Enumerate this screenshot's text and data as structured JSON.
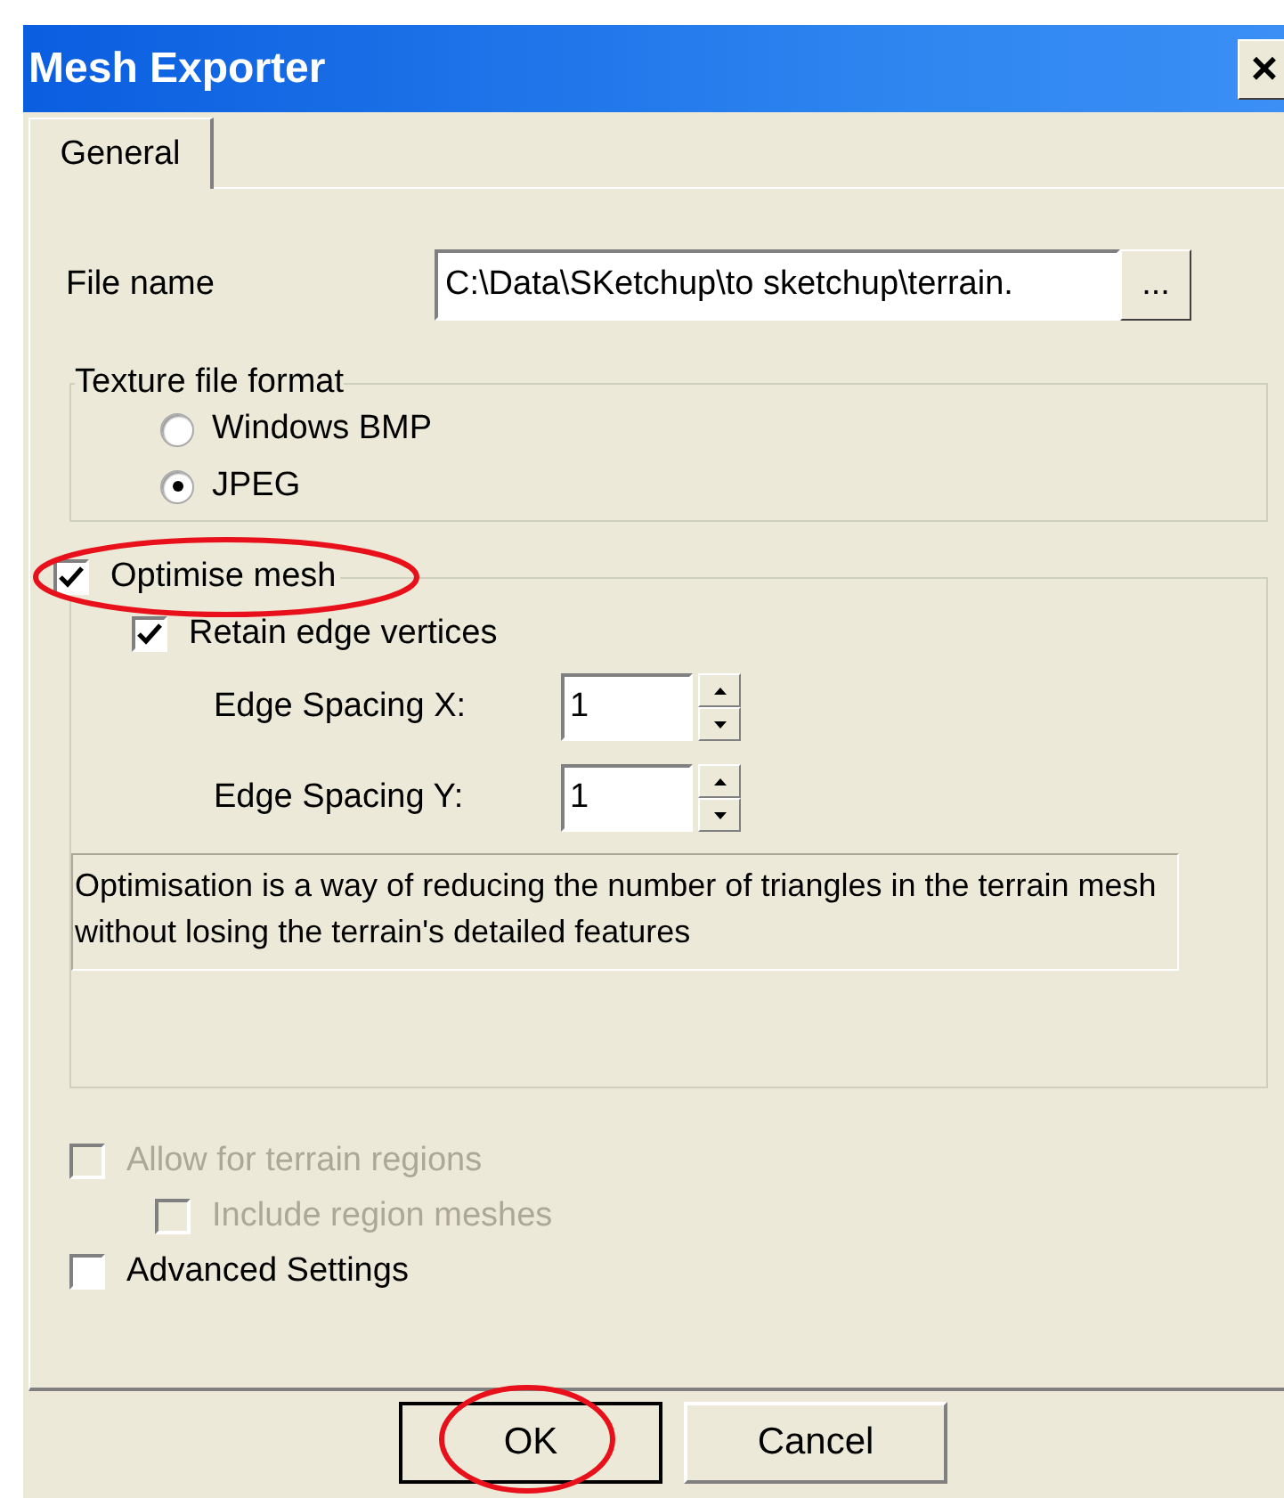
{
  "window": {
    "title": "Mesh Exporter",
    "close": "×"
  },
  "tabs": [
    {
      "label": "General",
      "selected": true
    }
  ],
  "file_name": {
    "label": "File name",
    "value": "C:\\Data\\SKetchup\\to sketchup\\terrain.",
    "browse": "..."
  },
  "texture_format": {
    "legend": "Texture file format",
    "options": [
      {
        "label": "Windows BMP",
        "selected": false
      },
      {
        "label": "JPEG",
        "selected": true
      }
    ]
  },
  "optimise": {
    "label": "Optimise mesh",
    "checked": true,
    "highlighted": true,
    "retain": {
      "label": "Retain edge vertices",
      "checked": true
    },
    "spacings": [
      {
        "label": "Edge Spacing X:",
        "value": "1"
      },
      {
        "label": "Edge Spacing Y:",
        "value": "1"
      }
    ],
    "description": "Optimisation is a way of reducing the number of triangles in the terrain mesh without losing the terrain's detailed features"
  },
  "options": [
    {
      "label": "Allow for terrain regions",
      "checked": false,
      "disabled": true,
      "indented": false
    },
    {
      "label": "Include region meshes",
      "checked": false,
      "disabled": true,
      "indented": true
    },
    {
      "label": "Advanced Settings",
      "checked": false,
      "disabled": false,
      "indented": false
    }
  ],
  "buttons": [
    {
      "label": "OK",
      "highlighted": true
    },
    {
      "label": "Cancel",
      "highlighted": false
    }
  ]
}
